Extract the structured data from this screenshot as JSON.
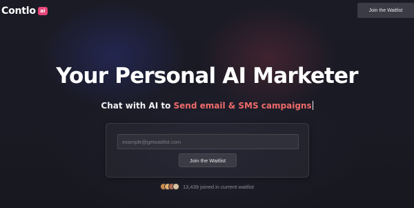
{
  "header": {
    "logo_text": "Contlo",
    "logo_badge": "ai",
    "cta_label": "Join the Waitlist"
  },
  "hero": {
    "title": "Your Personal AI Marketer",
    "subtitle_static": "Chat with AI to ",
    "subtitle_accent": "Send email & SMS campaigns"
  },
  "form": {
    "email_placeholder": "example@getwaitlist.com",
    "submit_label": "Join the Waitlist"
  },
  "stats": {
    "text": "13,439 joined in current waitlist"
  },
  "colors": {
    "background": "#181822",
    "accent_text": "#ef6b6b",
    "logo_badge": "#e8477a",
    "button": "#3a3b45"
  }
}
